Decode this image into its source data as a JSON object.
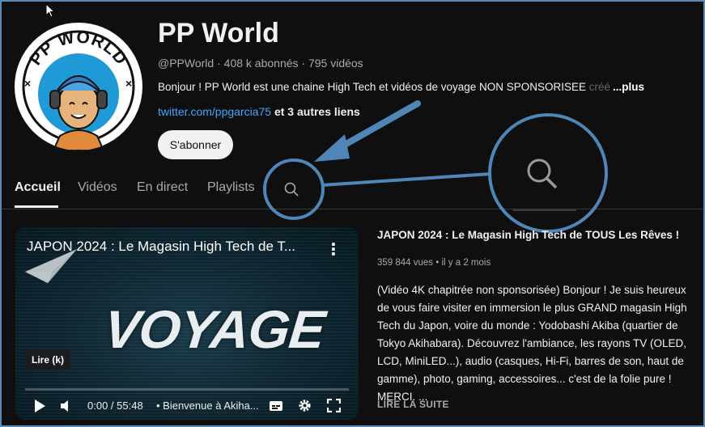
{
  "channel": {
    "title": "PP World",
    "handle": "@PPWorld",
    "subscribers": "408 k abonnés",
    "videos": "795 vidéos",
    "meta_sep": " · ",
    "description": "Bonjour ! PP World est une chaine High Tech et vidéos de voyage NON SPONSORISEE ",
    "description_fade": "créé",
    "more_label": "...plus",
    "link_text": "twitter.com/ppgarcia75",
    "other_links": " et 3 autres liens",
    "subscribe_label": "S'abonner",
    "avatar_text": "PP WORLD"
  },
  "tabs": [
    {
      "label": "Accueil",
      "active": true
    },
    {
      "label": "Vidéos"
    },
    {
      "label": "En direct"
    },
    {
      "label": "Playlists"
    }
  ],
  "player": {
    "title": "JAPON 2024 : Le Magasin High Tech de T...",
    "overlay_text": "VOYAGE",
    "tooltip": "Lire (k)",
    "time": "0:00 / 55:48",
    "chapter": "• Bienvenue à Akiha...",
    "progress": 0
  },
  "video_info": {
    "title": "JAPON 2024 : Le Magasin High Tech de TOUS Les Rêves !",
    "views": "359 844 vues",
    "age": "il y a 2 mois",
    "meta_sep": " • ",
    "description": "(Vidéo 4K chapitrée non sponsorisée) Bonjour ! Je suis heureux de vous faire visiter en immersion le plus GRAND magasin High Tech du Japon, voire du monde : Yodobashi Akiba (quartier de Tokyo Akihabara). Découvrez l'ambiance, les rayons TV (OLED, LCD, MiniLED...), audio (casques, Hi-Fi, barres de son, haut de gamme), photo, gaming, accessoires... c'est de la folie pure ! MERCI. ...",
    "read_more": "LIRE LA SUITE"
  },
  "colors": {
    "background": "#0f0f0f",
    "link": "#3ea6ff",
    "annotation": "#4f86b8"
  },
  "icons": [
    "search-icon",
    "play-icon",
    "volume-icon",
    "subtitles-icon",
    "settings-icon",
    "fullscreen-icon",
    "more-vert-icon",
    "mouse-cursor-icon"
  ]
}
